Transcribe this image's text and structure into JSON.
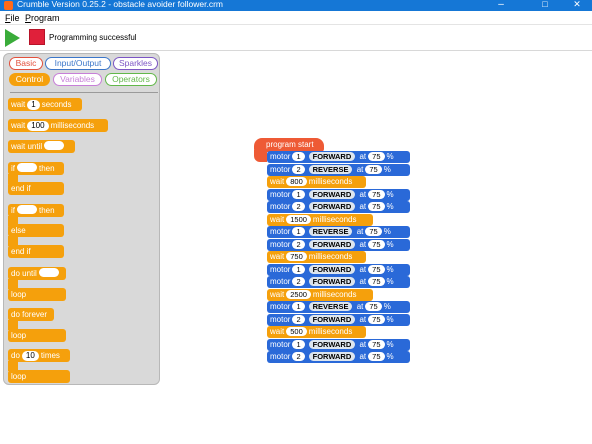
{
  "window": {
    "title": "Crumble Version 0.25.2 - obstacle avoider follower.crm",
    "minimize": "–",
    "maximize": "□",
    "close": "✕"
  },
  "menu": [
    {
      "label": "File",
      "underline": "F",
      "rest": "ile"
    },
    {
      "label": "Program",
      "underline": "P",
      "rest": "rogram"
    }
  ],
  "toolbar": {
    "run_icon": "play-icon",
    "stop_icon": "stop-icon",
    "status": "Programming successful"
  },
  "colors": {
    "titlebar": "#1577d6",
    "control": "#f5a00c",
    "motor": "#2a69d8",
    "hat": "#ee5a35",
    "run": "#3aac3a",
    "stop": "#e0203a"
  },
  "palette": {
    "categories": [
      {
        "label": "Basic",
        "color": "#e2503c"
      },
      {
        "label": "Input/Output",
        "color": "#3b76c9"
      },
      {
        "label": "Sparkles",
        "color": "#7c55c4"
      },
      {
        "label": "Control",
        "color": "#f5a00c",
        "active": true
      },
      {
        "label": "Variables",
        "color": "#c77fd8"
      },
      {
        "label": "Operators",
        "color": "#62b84a"
      }
    ],
    "blocks": {
      "wait_seconds": {
        "pre": "wait",
        "value": "1",
        "post": "seconds"
      },
      "wait_ms": {
        "pre": "wait",
        "value": "100",
        "post": "milliseconds"
      },
      "wait_until": {
        "pre": "wait until"
      },
      "if_then": {
        "pre": "if",
        "post": "then",
        "end": "end if"
      },
      "if_else": {
        "pre": "if",
        "post": "then",
        "else": "else",
        "end": "end if"
      },
      "do_until": {
        "pre": "do until",
        "end": "loop"
      },
      "do_forever": {
        "pre": "do forever",
        "end": "loop"
      },
      "do_times": {
        "pre": "do",
        "value": "10",
        "post": "times",
        "end": "loop"
      }
    }
  },
  "script": {
    "hat": "program start",
    "blocks": [
      {
        "kind": "motor",
        "label": "motor",
        "motor": "1",
        "dir": "FORWARD",
        "at": "at",
        "speed": "75",
        "unit": "%"
      },
      {
        "kind": "motor",
        "label": "motor",
        "motor": "2",
        "dir": "REVERSE",
        "at": "at",
        "speed": "75",
        "unit": "%"
      },
      {
        "kind": "wait",
        "label": "wait",
        "value": "800",
        "unit": "milliseconds"
      },
      {
        "kind": "motor",
        "label": "motor",
        "motor": "1",
        "dir": "FORWARD",
        "at": "at",
        "speed": "75",
        "unit": "%"
      },
      {
        "kind": "motor",
        "label": "motor",
        "motor": "2",
        "dir": "FORWARD",
        "at": "at",
        "speed": "75",
        "unit": "%"
      },
      {
        "kind": "wait",
        "label": "wait",
        "value": "1500",
        "unit": "milliseconds"
      },
      {
        "kind": "motor",
        "label": "motor",
        "motor": "1",
        "dir": "REVERSE",
        "at": "at",
        "speed": "75",
        "unit": "%"
      },
      {
        "kind": "motor",
        "label": "motor",
        "motor": "2",
        "dir": "FORWARD",
        "at": "at",
        "speed": "75",
        "unit": "%"
      },
      {
        "kind": "wait",
        "label": "wait",
        "value": "750",
        "unit": "milliseconds"
      },
      {
        "kind": "motor",
        "label": "motor",
        "motor": "1",
        "dir": "FORWARD",
        "at": "at",
        "speed": "75",
        "unit": "%"
      },
      {
        "kind": "motor",
        "label": "motor",
        "motor": "2",
        "dir": "FORWARD",
        "at": "at",
        "speed": "75",
        "unit": "%"
      },
      {
        "kind": "wait",
        "label": "wait",
        "value": "2500",
        "unit": "milliseconds"
      },
      {
        "kind": "motor",
        "label": "motor",
        "motor": "1",
        "dir": "REVERSE",
        "at": "at",
        "speed": "75",
        "unit": "%"
      },
      {
        "kind": "motor",
        "label": "motor",
        "motor": "2",
        "dir": "FORWARD",
        "at": "at",
        "speed": "75",
        "unit": "%"
      },
      {
        "kind": "wait",
        "label": "wait",
        "value": "500",
        "unit": "milliseconds"
      },
      {
        "kind": "motor",
        "label": "motor",
        "motor": "1",
        "dir": "FORWARD",
        "at": "at",
        "speed": "75",
        "unit": "%"
      },
      {
        "kind": "motor",
        "label": "motor",
        "motor": "2",
        "dir": "FORWARD",
        "at": "at",
        "speed": "75",
        "unit": "%"
      }
    ]
  }
}
